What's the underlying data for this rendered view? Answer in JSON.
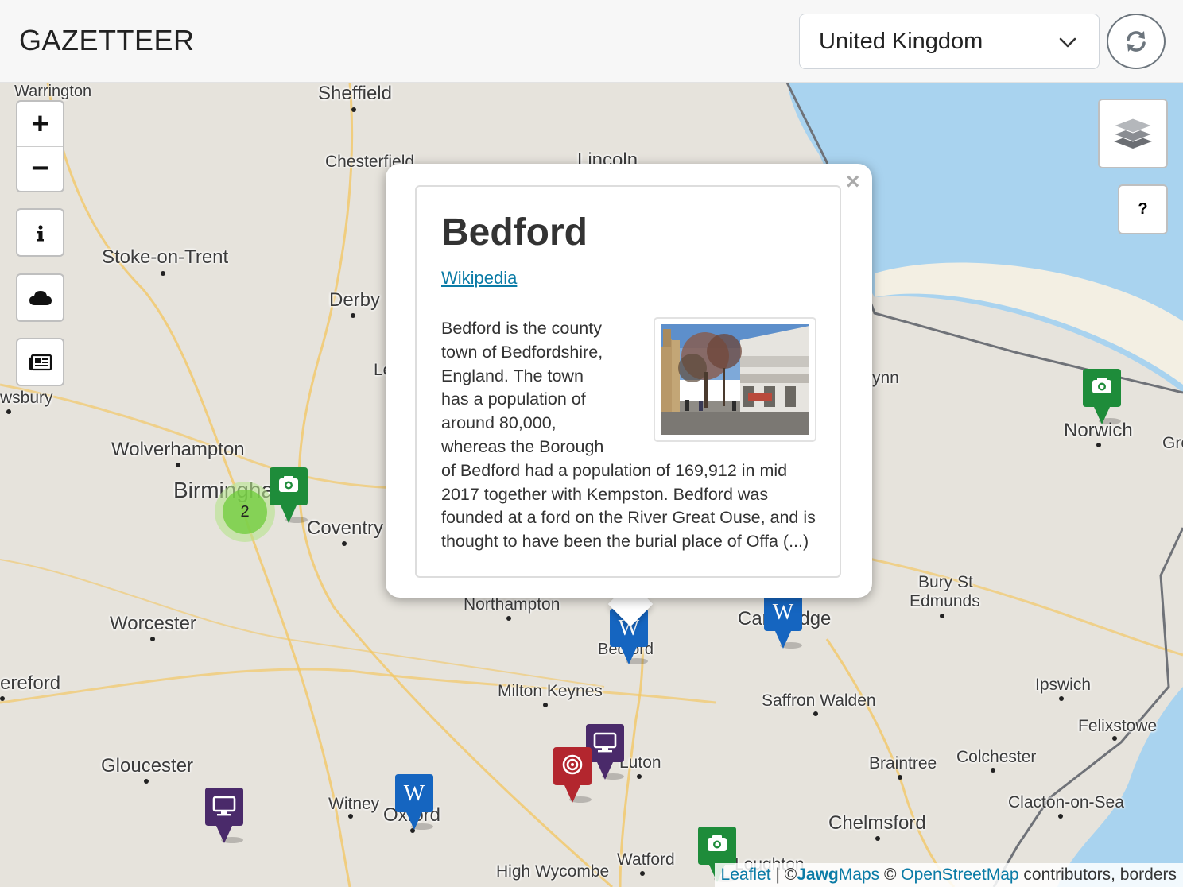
{
  "header": {
    "brand": "GAZETTEER",
    "country_selected": "United Kingdom",
    "refresh_icon": "refresh-icon"
  },
  "map": {
    "cities": [
      {
        "name": "Warrington"
      },
      {
        "name": "Sheffield"
      },
      {
        "name": "Chesterfield"
      },
      {
        "name": "Lincoln"
      },
      {
        "name": "Stoke-on-Trent"
      },
      {
        "name": "Derby"
      },
      {
        "name": "wsbury"
      },
      {
        "name": "Wolverhampton"
      },
      {
        "name": "Birmingham"
      },
      {
        "name": "Coventry"
      },
      {
        "name": "Worcester"
      },
      {
        "name": "ereford"
      },
      {
        "name": "Gloucester"
      },
      {
        "name": "Witney"
      },
      {
        "name": "Oxford"
      },
      {
        "name": "High Wycombe"
      },
      {
        "name": "Watford"
      },
      {
        "name": "Luton"
      },
      {
        "name": "Milton Keynes"
      },
      {
        "name": "Northampton"
      },
      {
        "name": "Bedford"
      },
      {
        "name": "Cambridge"
      },
      {
        "name": "Saffron Walden"
      },
      {
        "name": "Bury St"
      },
      {
        "name": "Edmunds"
      },
      {
        "name": "Ipswich"
      },
      {
        "name": "Felixstowe"
      },
      {
        "name": "Colchester"
      },
      {
        "name": "Braintree"
      },
      {
        "name": "Clacton-on-Sea"
      },
      {
        "name": "Chelmsford"
      },
      {
        "name": "Norwich"
      },
      {
        "name": "Gre"
      },
      {
        "name": "ynn"
      },
      {
        "name": "Loughton"
      },
      {
        "name": "Le"
      }
    ],
    "cluster_count": "2",
    "marker_colors": {
      "photo": "#1e8c3a",
      "wiki": "#1565c0",
      "tv": "#4a2a6a",
      "target": "#b3262e"
    },
    "controls": {
      "zoom_in": "+",
      "zoom_out": "−",
      "info_icon": "info-icon",
      "weather_icon": "cloud-icon",
      "news_icon": "newspaper-icon",
      "layers_icon": "layers-icon",
      "help": "?"
    }
  },
  "popup": {
    "title": "Bedford",
    "link": "Wikipedia",
    "summary": "Bedford is the county town of Bedfordshire, England. The town has a population of around 80,000, whereas the Borough of Bedford had a population of 169,912 in mid 2017 together with Kempston. Bedford was founded at a ford on the River Great Ouse, and is thought to have been the burial place of Offa (...)",
    "close": "×"
  },
  "attribution": {
    "leaflet": "Leaflet",
    "sep": "|",
    "copy1": "©",
    "jawg_bold": "Jawg",
    "jawg_rest": "Maps",
    "copy2": "©",
    "osm": "OpenStreetMap",
    "rest": "contributors, borders"
  }
}
